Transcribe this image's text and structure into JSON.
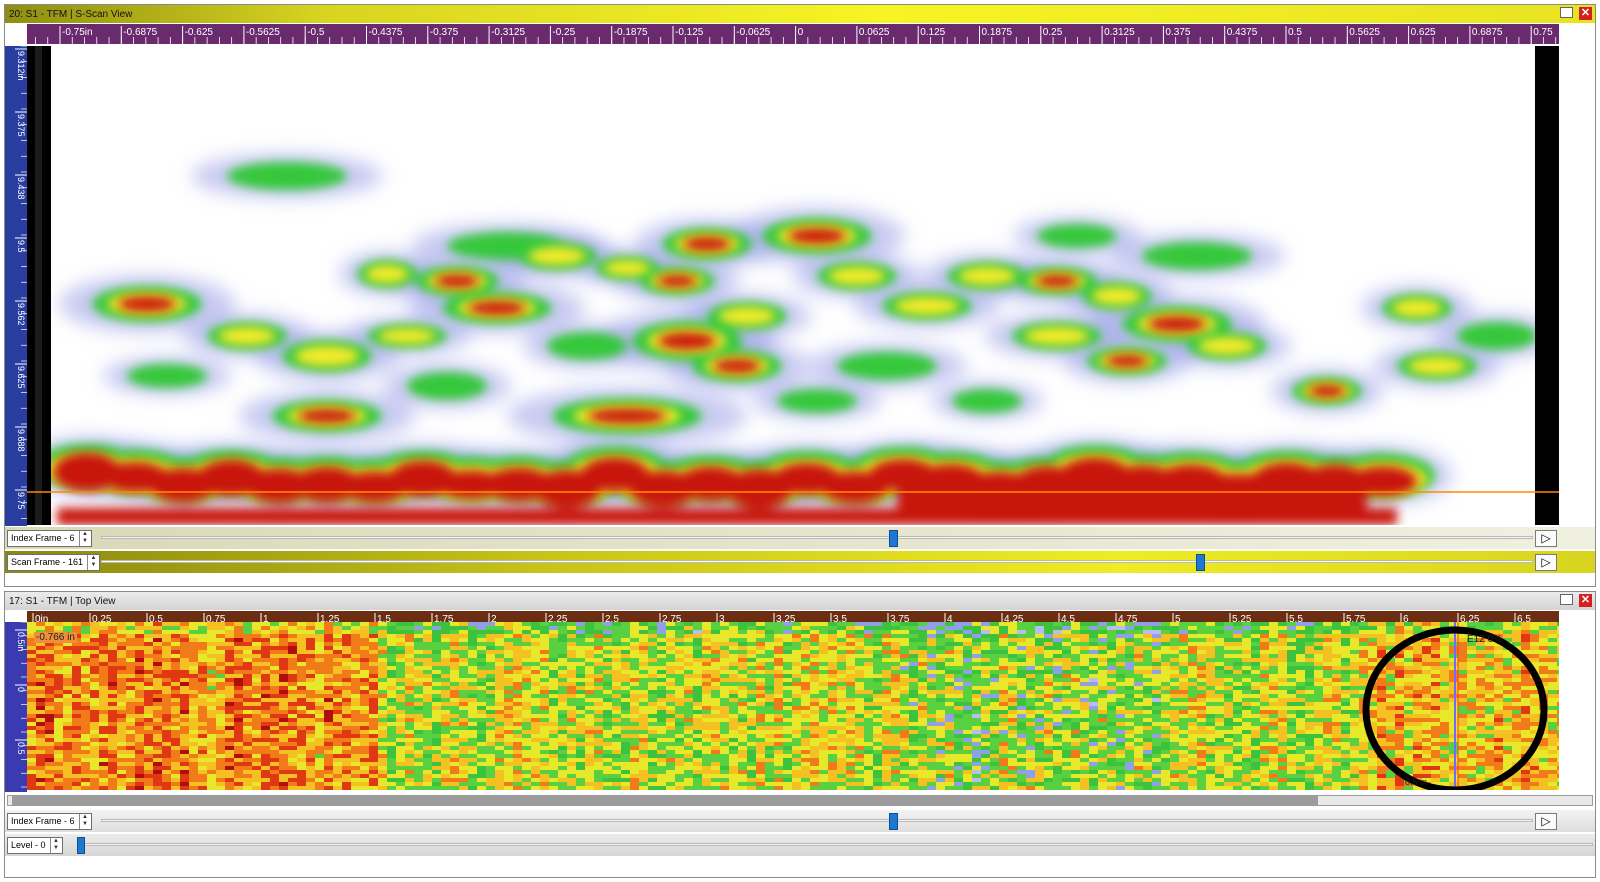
{
  "sscan": {
    "title": "20: S1 - TFM | S-Scan View",
    "ruler_labels": [
      "-0.75in",
      "-0.6875",
      "-0.625",
      "-0.5625",
      "-0.5",
      "-0.4375",
      "-0.375",
      "-0.3125",
      "-0.25",
      "-0.1875",
      "-0.125",
      "-0.0625",
      "0",
      "0.0625",
      "0.125",
      "0.1875",
      "0.25",
      "0.3125",
      "0.375",
      "0.4375",
      "0.5",
      "0.5625",
      "0.625",
      "0.6875",
      "0.75"
    ],
    "depth_labels": [
      "9.312in",
      "9.375",
      "9.438",
      "9.5",
      "9.562",
      "9.625",
      "9.688",
      "9.75"
    ],
    "index_frame_label": "Index Frame - 6",
    "scan_frame_label": "Scan Frame - 161",
    "index_frame_position": 0.55,
    "scan_frame_position": 0.765
  },
  "topview": {
    "title": "17: S1 - TFM | Top View",
    "ruler_labels": [
      "0in",
      "0.25",
      "0.5",
      "0.75",
      "1",
      "1.25",
      "1.5",
      "1.75",
      "2",
      "2.25",
      "2.5",
      "2.75",
      "3",
      "3.25",
      "3.5",
      "3.75",
      "4",
      "4.25",
      "4.5",
      "4.75",
      "5",
      "5.25",
      "5.5",
      "5.75",
      "6",
      "6.25",
      "6.5"
    ],
    "depth_labels": [
      "0.5in",
      "0",
      "0.5"
    ],
    "cursor_readout": "-0.766 in",
    "gate_readout": "E12 0%",
    "bottom_readout": "0.5 in",
    "index_frame_label": "Index Frame - 6",
    "level_label": "Level - 0",
    "index_frame_position": 0.55,
    "level_position": 0.0
  },
  "colors": {
    "title_bar_active": "#e8e420",
    "ruler_purple": "#6a2b6e",
    "ruler_brown": "#6b2e12",
    "thumb": "#1e78d2",
    "annotation_circle": "#000000",
    "cursor_line": "#ff8a00"
  }
}
